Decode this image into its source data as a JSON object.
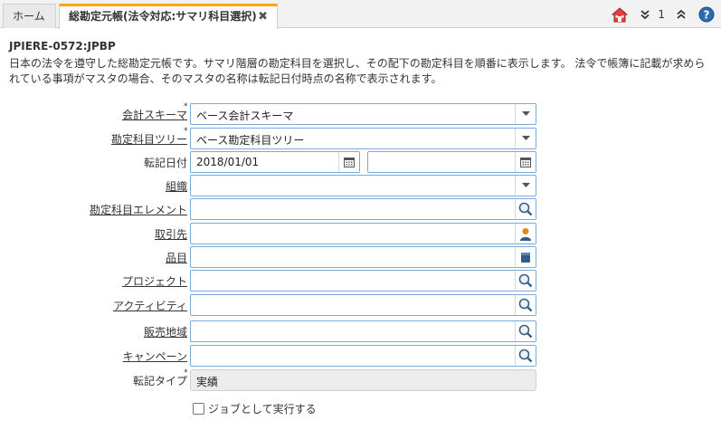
{
  "tabs": [
    {
      "label": "ホーム"
    },
    {
      "label": "総勘定元帳(法令対応:サマリ科目選択)",
      "close": "✖"
    }
  ],
  "toolbar": {
    "count": "1"
  },
  "process": {
    "id": "JPIERE-0572:JPBP",
    "description": "日本の法令を遵守した総勘定元帳です。サマリ階層の勘定科目を選択し、その配下の勘定科目を順番に表示します。 法令で帳簿に記載が求められている事項がマスタの場合、そのマスタの名称は転記日付時点の名称で表示されます。"
  },
  "form": {
    "accounting_schema": {
      "label": "会計スキーマ",
      "value": "ベース会計スキーマ",
      "required": "*"
    },
    "account_tree": {
      "label": "勘定科目ツリー",
      "value": "ベース勘定科目ツリー",
      "required": "*"
    },
    "date_acct": {
      "label": "転記日付",
      "from": "2018/01/01",
      "to": ""
    },
    "organization": {
      "label": "組織",
      "value": ""
    },
    "account_element": {
      "label": "勘定科目エレメント",
      "value": ""
    },
    "business_partner": {
      "label": "取引先",
      "value": ""
    },
    "product": {
      "label": "品目",
      "value": ""
    },
    "project": {
      "label": "プロジェクト",
      "value": ""
    },
    "activity": {
      "label": "アクティビティ",
      "value": ""
    },
    "sales_region": {
      "label": "販売地域",
      "value": ""
    },
    "campaign": {
      "label": "キャンペーン",
      "value": ""
    },
    "posting_type": {
      "label": "転記タイプ",
      "value": "実績",
      "required": "*"
    },
    "run_as_job": {
      "label": "ジョブとして実行する",
      "checked": false
    }
  }
}
